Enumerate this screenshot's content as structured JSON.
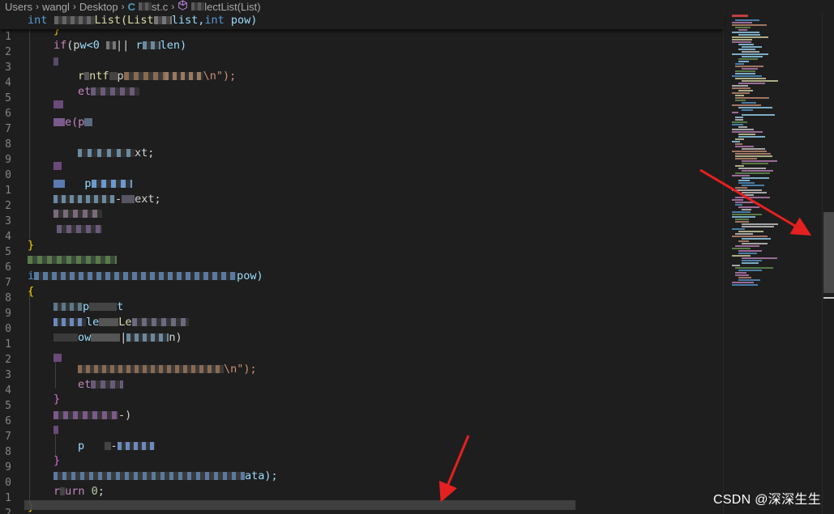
{
  "breadcrumb": {
    "items": [
      "Users",
      "wangl",
      "Desktop",
      "st.c",
      "lectList(List)"
    ],
    "file_lang_icon": "C"
  },
  "gutter": {
    "line_numbers": [
      "1",
      "1",
      "2",
      "3",
      "4",
      "5",
      "6",
      "7",
      "8",
      "9",
      "0",
      "1",
      "2",
      "3",
      "4",
      "5",
      "6",
      "7",
      "8",
      "9",
      "0",
      "1",
      "2",
      "3",
      "4",
      "5",
      "6",
      "7",
      "8",
      "9",
      "0",
      "1",
      "2"
    ]
  },
  "code": {
    "sticky": {
      "kw": "int",
      "mid": "List(List",
      "mid2": "list,",
      "kw2": "int",
      "tail": "pow)"
    },
    "l_if_1": {
      "kw": "if",
      "a": "(p",
      "b": "w<0 ",
      "c": "|| ",
      "d": "r",
      "e": "len)"
    },
    "l_printf_1": {
      "a": "r",
      "b": "ntf",
      "c": "p",
      "str": "\\n\");"
    },
    "l_ret_1": {
      "a": "et"
    },
    "l_while": {
      "a": "e(p"
    },
    "l_next_1": {
      "a": "xt;"
    },
    "l_p": {
      "a": "p"
    },
    "l_next_2": {
      "a": "-",
      "b": "ext;"
    },
    "l_close": {
      "a": "}"
    },
    "l_func2": {
      "a": "i",
      "b": "pow)"
    },
    "l_open": {
      "a": "{"
    },
    "l_pl": {
      "a": "p",
      "b": "t"
    },
    "l_le": {
      "a": "le",
      "b": "Le"
    },
    "l_ow": {
      "a": "ow",
      "b": "|",
      "c": "n)"
    },
    "l_str2": {
      "a": "\\n\");"
    },
    "l_ret2": {
      "a": "et"
    },
    "l_close2": {
      "a": "}"
    },
    "l_pdash": {
      "a": "-)"
    },
    "l_p2": {
      "a": "p",
      "b": "-"
    },
    "l_close3": {
      "a": "}"
    },
    "l_data": {
      "a": "ata);"
    },
    "l_return0": {
      "kw": "r",
      "b": "urn ",
      "num": "0",
      "semi": ";"
    },
    "l_final": {
      "a": "}"
    }
  },
  "watermark": "CSDN @深深生生",
  "colors": {
    "background": "#1e1e1e",
    "keyword": "#569cd6",
    "control": "#c586c0",
    "string": "#ce9178",
    "variable": "#9cdcfe",
    "function": "#dcdcaa",
    "number": "#b5cea8",
    "brace": "#ffd700",
    "annotation_arrow": "#e52020"
  },
  "icons": [
    "chevron-right-icon",
    "c-file-icon",
    "cube-icon"
  ]
}
